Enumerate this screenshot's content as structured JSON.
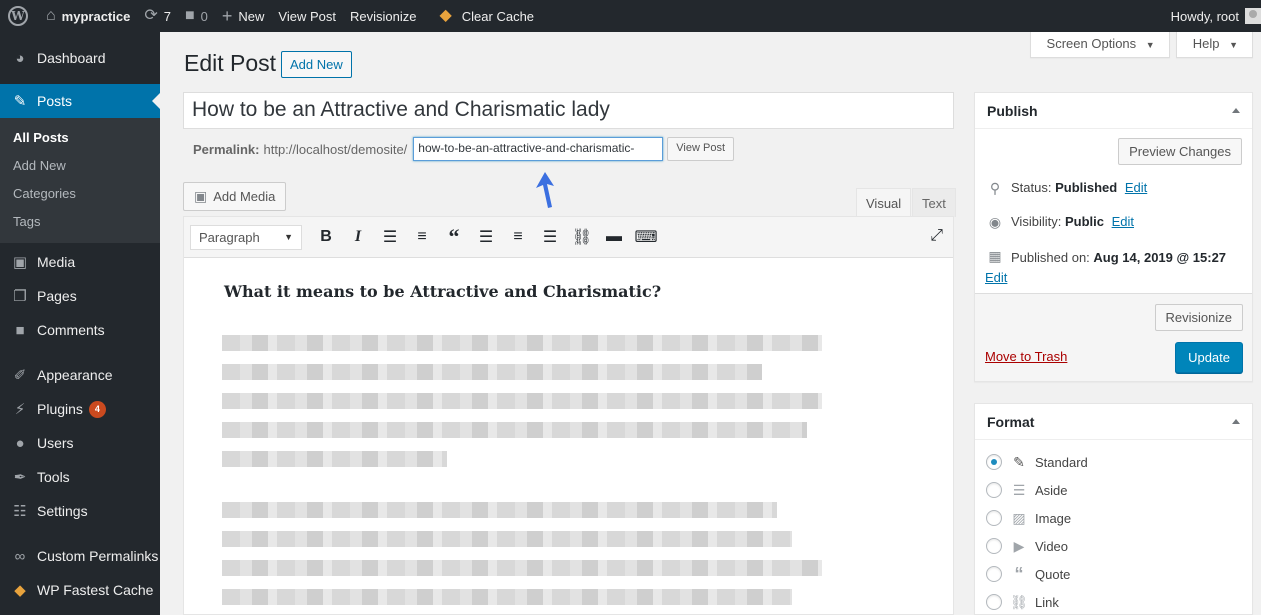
{
  "adminbar": {
    "site_name": "mypractice",
    "updates_count": "7",
    "comments_count": "0",
    "new_label": "New",
    "view_post_label": "View Post",
    "revisionize_label": "Revisionize",
    "clear_cache_label": "Clear Cache",
    "howdy": "Howdy, root"
  },
  "sidebar": {
    "items": [
      {
        "label": "Dashboard"
      },
      {
        "label": "Posts"
      },
      {
        "label": "Media"
      },
      {
        "label": "Pages"
      },
      {
        "label": "Comments"
      },
      {
        "label": "Appearance"
      },
      {
        "label": "Plugins",
        "badge": "4"
      },
      {
        "label": "Users"
      },
      {
        "label": "Tools"
      },
      {
        "label": "Settings"
      },
      {
        "label": "Custom Permalinks"
      },
      {
        "label": "WP Fastest Cache"
      }
    ],
    "posts_submenu": [
      "All Posts",
      "Add New",
      "Categories",
      "Tags"
    ]
  },
  "screen_meta": {
    "screen_options": "Screen Options",
    "help": "Help"
  },
  "header": {
    "title": "Edit Post",
    "add_new": "Add New"
  },
  "post": {
    "title": "How to be an Attractive and Charismatic lady",
    "permalink_label": "Permalink:",
    "permalink_base": "http://localhost/demosite/",
    "slug": "how-to-be-an-attractive-and-charismatic-",
    "view_post_btn": "View Post"
  },
  "editor": {
    "add_media": "Add Media",
    "tab_visual": "Visual",
    "tab_text": "Text",
    "format_select": "Paragraph",
    "heading": "What it means to be Attractive and Charismatic?"
  },
  "publish": {
    "title": "Publish",
    "preview_changes": "Preview Changes",
    "status_label": "Status:",
    "status_value": "Published",
    "visibility_label": "Visibility:",
    "visibility_value": "Public",
    "published_on_label": "Published on:",
    "published_on_value": "Aug 14, 2019 @ 15:27",
    "edit_link": "Edit",
    "revisionize_btn": "Revisionize",
    "move_to_trash": "Move to Trash",
    "update_btn": "Update"
  },
  "format": {
    "title": "Format",
    "options": [
      "Standard",
      "Aside",
      "Image",
      "Video",
      "Quote",
      "Link"
    ],
    "selected": "Standard"
  },
  "colors": {
    "adminbar_bg": "#23282d",
    "accent": "#0073aa",
    "update_button": "#0085ba",
    "trash_link": "#aa0000",
    "plugins_badge": "#ca4a1f"
  }
}
